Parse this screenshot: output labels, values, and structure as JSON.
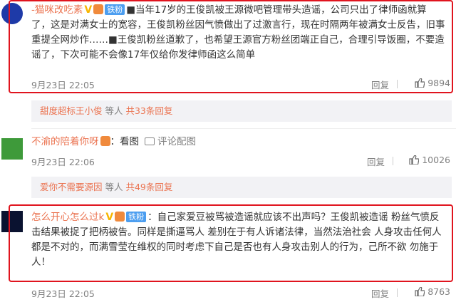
{
  "comments": [
    {
      "username": "-猫咪改吃素",
      "fan_badge": "铁粉",
      "text_lines": [
        "■当年17岁的王俊凯被王源微吧管理带头造谣，公司只出了律师函就算",
        "了，这是对满女士的宽容，王俊凯粉丝因气愤做出了过激言行，现在时隔两年被满女士反告，旧事",
        "重提全网炒作……■王俊凯粉丝道歉了，也希望王源官方粉丝团端正自己，合理引导饭圈，不要造",
        "谣了，下次可能不会像17年仅给你发律师函这么简单"
      ],
      "time": "9月23日 22:05",
      "reply_label": "回复",
      "likes": "9894"
    },
    {
      "username": "不渝的陪着你呀",
      "colon": "：",
      "image_link": "看图",
      "image_comment_label": "评论配图",
      "time": "9月23日 22:06",
      "reply_label": "回复",
      "likes": "10026"
    },
    {
      "username": "怎么开心怎么过k",
      "fan_badge": "铁粉",
      "text_lines": [
        "：自己家爱豆被骂被造谣就应该不出声吗？王俊凯被造谣 粉丝气愤反",
        "击结果被捉了把柄被告。同样是撕逼骂人 差别在于有人诉诸法律，当然法治社会 人身攻击任何人",
        "都是不对的，而满雪莹在维权的同时考虑下自己是否也有人身攻击别人的行为，己所不欲 勿施于",
        "人！"
      ],
      "time": "9月23日 22:05",
      "reply_label": "回复",
      "likes": "8763"
    }
  ],
  "subreplies": [
    {
      "user": "甜度超标王小俊",
      "middle": " 等人 ",
      "link": "共33条回复"
    },
    {
      "user": "爱你不需要源因",
      "middle": " 等人 ",
      "link": "共49条回复"
    }
  ],
  "colors": {
    "highlight": "#e0141e",
    "username": "#eb7350",
    "badge": "#4c9ef0"
  }
}
